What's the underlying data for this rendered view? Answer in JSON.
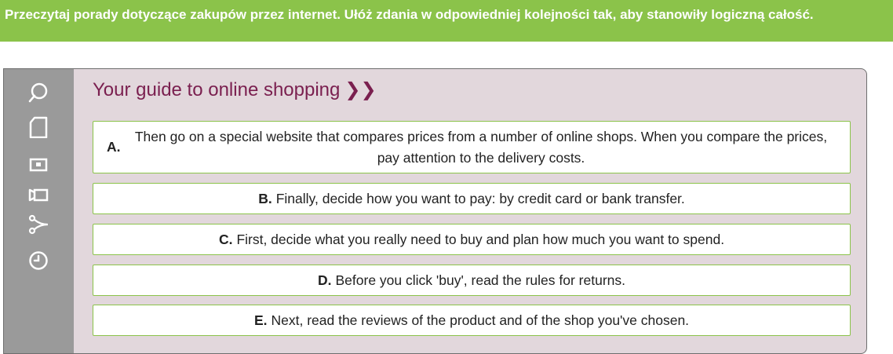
{
  "instruction": "Przeczytaj porady dotyczące zakupów przez internet. Ułóż zdania w odpowiedniej kolejności tak, aby stanowiły logiczną całość.",
  "card": {
    "title": "Your guide to online shopping",
    "title_chevron": "❯❯"
  },
  "sidebar": {
    "icons": [
      "search-icon",
      "document-icon",
      "photo-icon",
      "video-icon",
      "share-icon",
      "clock-icon"
    ]
  },
  "items": [
    {
      "letter": "A.",
      "text": "Then go on a special website that compares prices from a number of online shops. When you compare the prices, pay attention to the delivery costs."
    },
    {
      "letter": "B.",
      "text": "Finally, decide how you want to pay: by credit card or bank transfer."
    },
    {
      "letter": "C.",
      "text": "First, decide what you really need to buy and plan how much you want to spend."
    },
    {
      "letter": "D.",
      "text": "Before you click 'buy', read the rules for returns."
    },
    {
      "letter": "E.",
      "text": "Next, read the reviews of the product and of the shop you've chosen."
    }
  ],
  "colors": {
    "banner": "#8bc34a",
    "title": "#7a1f4f",
    "card_bg": "#e2d7dc",
    "sidebar": "#9a9a9a",
    "item_border": "#8bc34a"
  }
}
